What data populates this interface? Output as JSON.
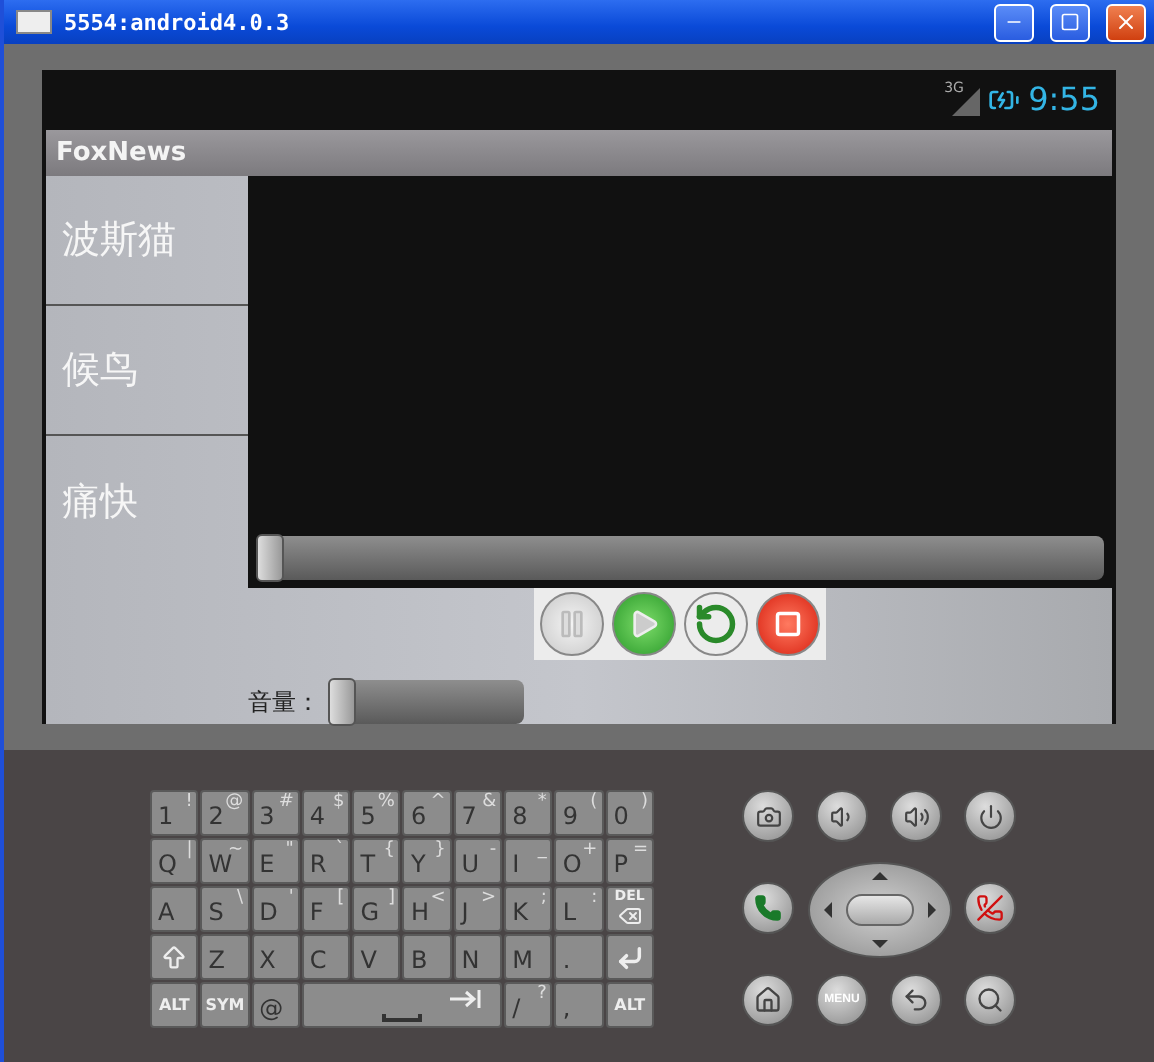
{
  "window": {
    "title": "5554:android4.0.3"
  },
  "status_bar": {
    "network": "3G",
    "time": "9:55"
  },
  "app_bar": {
    "title": "FoxNews"
  },
  "list": [
    {
      "label": "波斯猫"
    },
    {
      "label": "候鸟"
    },
    {
      "label": "痛快"
    }
  ],
  "seek": {
    "level": 0
  },
  "media_buttons": [
    {
      "kind": "pause"
    },
    {
      "kind": "play"
    },
    {
      "kind": "replay"
    },
    {
      "kind": "stop"
    }
  ],
  "volume": {
    "label": "音量：",
    "level": 0
  },
  "keyboard": [
    [
      {
        "kind": "char",
        "label": "1",
        "alt": "!"
      },
      {
        "kind": "char",
        "label": "2",
        "alt": "@"
      },
      {
        "kind": "char",
        "label": "3",
        "alt": "#"
      },
      {
        "kind": "char",
        "label": "4",
        "alt": "$"
      },
      {
        "kind": "char",
        "label": "5",
        "alt": "%"
      },
      {
        "kind": "char",
        "label": "6",
        "alt": "^"
      },
      {
        "kind": "char",
        "label": "7",
        "alt": "&"
      },
      {
        "kind": "char",
        "label": "8",
        "alt": "*"
      },
      {
        "kind": "char",
        "label": "9",
        "alt": "("
      },
      {
        "kind": "char",
        "label": "0",
        "alt": ")"
      }
    ],
    [
      {
        "kind": "char",
        "label": "Q",
        "alt": "|"
      },
      {
        "kind": "char",
        "label": "W",
        "alt": "~"
      },
      {
        "kind": "char",
        "label": "E",
        "alt": "\""
      },
      {
        "kind": "char",
        "label": "R",
        "alt": "`"
      },
      {
        "kind": "char",
        "label": "T",
        "alt": "{"
      },
      {
        "kind": "char",
        "label": "Y",
        "alt": "}"
      },
      {
        "kind": "char",
        "label": "U",
        "alt": "-"
      },
      {
        "kind": "char",
        "label": "I",
        "alt": "_"
      },
      {
        "kind": "char",
        "label": "O",
        "alt": "+"
      },
      {
        "kind": "char",
        "label": "P",
        "alt": "="
      }
    ],
    [
      {
        "kind": "char",
        "label": "A"
      },
      {
        "kind": "char",
        "label": "S",
        "alt": "\\"
      },
      {
        "kind": "char",
        "label": "D",
        "alt": "'"
      },
      {
        "kind": "char",
        "label": "F",
        "alt": "["
      },
      {
        "kind": "char",
        "label": "G",
        "alt": "]"
      },
      {
        "kind": "char",
        "label": "H",
        "alt": "<"
      },
      {
        "kind": "char",
        "label": "J",
        "alt": ">"
      },
      {
        "kind": "char",
        "label": "K",
        "alt": ";"
      },
      {
        "kind": "char",
        "label": "L",
        "alt": ":"
      },
      {
        "kind": "del",
        "label": "DEL"
      }
    ],
    [
      {
        "kind": "shift"
      },
      {
        "kind": "char",
        "label": "Z"
      },
      {
        "kind": "char",
        "label": "X"
      },
      {
        "kind": "char",
        "label": "C"
      },
      {
        "kind": "char",
        "label": "V"
      },
      {
        "kind": "char",
        "label": "B"
      },
      {
        "kind": "char",
        "label": "N"
      },
      {
        "kind": "char",
        "label": "M"
      },
      {
        "kind": "char",
        "label": "."
      },
      {
        "kind": "enter"
      }
    ],
    [
      {
        "kind": "mod",
        "label": "ALT"
      },
      {
        "kind": "mod",
        "label": "SYM"
      },
      {
        "kind": "char",
        "label": "@"
      },
      {
        "kind": "space"
      },
      {
        "kind": "char",
        "label": "/",
        "alt": "?"
      },
      {
        "kind": "char",
        "label": ","
      },
      {
        "kind": "mod",
        "label": "ALT"
      }
    ]
  ],
  "hardware": {
    "menu_label": "MENU"
  }
}
